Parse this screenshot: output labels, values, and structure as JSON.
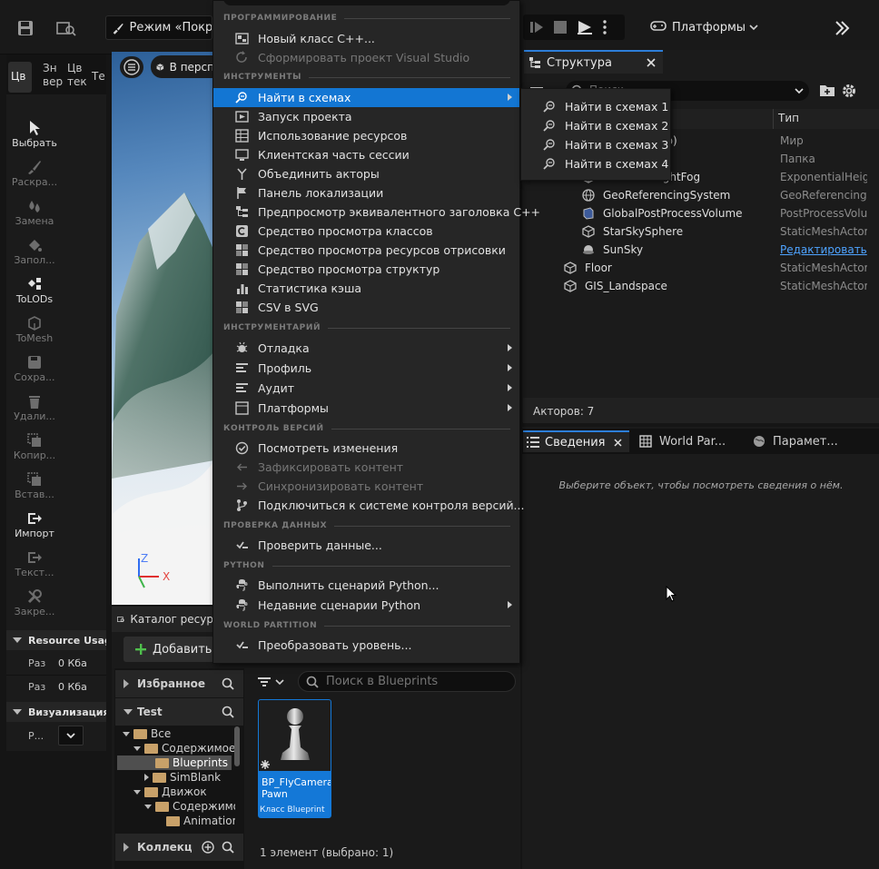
{
  "toolbar": {
    "mode_label": "Режим «Покрас",
    "platforms_label": "Платформы"
  },
  "left_tabs": [
    "Цв",
    "Зн вер",
    "Цв тек",
    "Те"
  ],
  "tools": [
    {
      "label": "Выбрать",
      "active": true
    },
    {
      "label": "Раскра...",
      "active": false
    },
    {
      "label": "Замена",
      "active": false
    },
    {
      "label": "Запол...",
      "active": false
    },
    {
      "label": "ToLODs",
      "active": true
    },
    {
      "label": "ToMesh",
      "active": false
    },
    {
      "label": "Сохра...",
      "active": false
    },
    {
      "label": "Удали...",
      "active": false
    },
    {
      "label": "Копир...",
      "active": false
    },
    {
      "label": "Встав...",
      "active": false
    },
    {
      "label": "Импорт",
      "active": true
    },
    {
      "label": "Текст...",
      "active": false
    },
    {
      "label": "Закре...",
      "active": false
    }
  ],
  "resource_usage": {
    "title": "Resource Usage",
    "rows": [
      {
        "label": "Раз",
        "value": "0 Кба"
      },
      {
        "label": "Раз",
        "value": "0 Кба"
      }
    ]
  },
  "visualization": {
    "title": "Визуализация",
    "row_label": "Р..."
  },
  "viewport": {
    "perspective_label": "В персп",
    "axis_z": "Z",
    "axis_x": "X"
  },
  "content_browser": {
    "tab_label": "Каталог ресур",
    "add_label": "Добавить",
    "favorites_label": "Избранное",
    "project_label": "Test",
    "collections_label": "Коллекци",
    "search_placeholder": "Поиск в Blueprints",
    "tree": [
      {
        "label": "Все",
        "indent": 0,
        "state": "open",
        "selected": false
      },
      {
        "label": "Содержимое",
        "indent": 1,
        "state": "open",
        "selected": false
      },
      {
        "label": "Blueprints",
        "indent": 2,
        "state": "none",
        "selected": true
      },
      {
        "label": "SimBlank",
        "indent": 2,
        "state": "closed",
        "selected": false
      },
      {
        "label": "Движок",
        "indent": 1,
        "state": "open",
        "selected": false
      },
      {
        "label": "Содержимое",
        "indent": 2,
        "state": "open",
        "selected": false
      },
      {
        "label": "Animation",
        "indent": 3,
        "state": "none",
        "selected": false
      }
    ],
    "asset": {
      "name": "BP_FlyCamera Pawn",
      "type": "Класс Blueprint"
    },
    "status": "1 элемент (выбрано: 1)"
  },
  "outliner": {
    "tab_label": "Структура",
    "search_placeholder": "Поиск",
    "col_type": "Тип",
    "rows": [
      {
        "name": "ор)",
        "type": "Мир",
        "icon": "world-icon",
        "link": false
      },
      {
        "name": "",
        "type": "Папка",
        "icon": "folder-icon",
        "link": false
      },
      {
        "name": "HeightFog",
        "type": "ExponentialHeightFog",
        "icon": "fog-icon",
        "link": false
      },
      {
        "name": "GeoReferencingSystem",
        "type": "GeoReferencingSystem",
        "icon": "globe-icon",
        "link": false
      },
      {
        "name": "GlobalPostProcessVolume",
        "type": "PostProcessVolume",
        "icon": "cube-icon",
        "link": false
      },
      {
        "name": "StarSkySphere",
        "type": "StaticMeshActor",
        "icon": "mesh-icon",
        "link": false
      },
      {
        "name": "SunSky",
        "type": "Редактировать",
        "icon": "sun-icon",
        "link": true
      },
      {
        "name": "Floor",
        "type": "StaticMeshActor",
        "icon": "mesh-icon",
        "link": false
      },
      {
        "name": "GIS_Landspace",
        "type": "StaticMeshActor",
        "icon": "mesh-icon",
        "link": false
      }
    ],
    "actors_count": "Акторов: 7"
  },
  "details": {
    "tabs": [
      "Сведения",
      "World Par...",
      "Парамет..."
    ],
    "empty_text": "Выберите объект, чтобы посмотреть сведения о нём."
  },
  "menu": {
    "sections": [
      {
        "title": "ПРОГРАММИРОВАНИЕ",
        "items": [
          {
            "label": "Новый класс C++...",
            "icon": "cpp-class-icon",
            "disabled": false,
            "submenu": false,
            "highlighted": false
          },
          {
            "label": "Сформировать проект Visual Studio",
            "icon": "refresh-icon",
            "disabled": true,
            "submenu": false,
            "highlighted": false
          }
        ]
      },
      {
        "title": "ИНСТРУМЕНТЫ",
        "items": [
          {
            "label": "Найти в схемах",
            "icon": "find-in-blueprints-icon",
            "disabled": false,
            "submenu": true,
            "highlighted": true
          },
          {
            "label": "Запуск проекта",
            "icon": "project-launcher-icon",
            "disabled": false,
            "submenu": false,
            "highlighted": false
          },
          {
            "label": "Использование ресурсов",
            "icon": "resource-usage-icon",
            "disabled": false,
            "submenu": false,
            "highlighted": false
          },
          {
            "label": "Клиентская часть сессии",
            "icon": "session-frontend-icon",
            "disabled": false,
            "submenu": false,
            "highlighted": false
          },
          {
            "label": "Объединить акторы",
            "icon": "merge-actors-icon",
            "disabled": false,
            "submenu": false,
            "highlighted": false
          },
          {
            "label": "Панель локализации",
            "icon": "flag-icon",
            "disabled": false,
            "submenu": false,
            "highlighted": false
          },
          {
            "label": "Предпросмотр эквивалентного заголовка C++",
            "icon": "header-preview-icon",
            "disabled": false,
            "submenu": false,
            "highlighted": false
          },
          {
            "label": "Средство просмотра классов",
            "icon": "class-viewer-icon",
            "disabled": false,
            "submenu": false,
            "highlighted": false
          },
          {
            "label": "Средство просмотра ресурсов отрисовки",
            "icon": "render-resource-icon",
            "disabled": false,
            "submenu": false,
            "highlighted": false
          },
          {
            "label": "Средство просмотра структур",
            "icon": "struct-viewer-icon",
            "disabled": false,
            "submenu": false,
            "highlighted": false
          },
          {
            "label": "Статистика кэша",
            "icon": "bar-chart-icon",
            "disabled": false,
            "submenu": false,
            "highlighted": false
          },
          {
            "label": "CSV в SVG",
            "icon": "csv-icon",
            "disabled": false,
            "submenu": false,
            "highlighted": false
          }
        ]
      },
      {
        "title": "ИНСТРУМЕНТАРИЙ",
        "items": [
          {
            "label": "Отладка",
            "icon": "debug-icon",
            "disabled": false,
            "submenu": true,
            "highlighted": false
          },
          {
            "label": "Профиль",
            "icon": "profile-icon",
            "disabled": false,
            "submenu": true,
            "highlighted": false
          },
          {
            "label": "Аудит",
            "icon": "audit-icon",
            "disabled": false,
            "submenu": true,
            "highlighted": false
          },
          {
            "label": "Платформы",
            "icon": "platforms-icon",
            "disabled": false,
            "submenu": true,
            "highlighted": false
          }
        ]
      },
      {
        "title": "КОНТРОЛЬ ВЕРСИЙ",
        "items": [
          {
            "label": "Посмотреть изменения",
            "icon": "check-circle-icon",
            "disabled": false,
            "submenu": false,
            "highlighted": false
          },
          {
            "label": "Зафиксировать контент",
            "icon": "arrow-left-icon",
            "disabled": true,
            "submenu": false,
            "highlighted": false
          },
          {
            "label": "Синхронизировать контент",
            "icon": "arrow-right-icon",
            "disabled": true,
            "submenu": false,
            "highlighted": false
          },
          {
            "label": "Подключиться к системе контроля версий...",
            "icon": "branch-icon",
            "disabled": false,
            "submenu": false,
            "highlighted": false
          }
        ]
      },
      {
        "title": "ПРОВЕРКА ДАННЫХ",
        "items": [
          {
            "label": "Проверить данные...",
            "icon": "validate-icon",
            "disabled": false,
            "submenu": false,
            "highlighted": false
          }
        ]
      },
      {
        "title": "PYTHON",
        "items": [
          {
            "label": "Выполнить сценарий Python...",
            "icon": "python-icon",
            "disabled": false,
            "submenu": false,
            "highlighted": false
          },
          {
            "label": "Недавние сценарии Python",
            "icon": "python-recent-icon",
            "disabled": false,
            "submenu": true,
            "highlighted": false
          }
        ]
      },
      {
        "title": "WORLD PARTITION",
        "items": [
          {
            "label": "Преобразовать уровень...",
            "icon": "convert-level-icon",
            "disabled": false,
            "submenu": false,
            "highlighted": false
          }
        ]
      }
    ]
  },
  "submenu": {
    "items": [
      "Найти в схемах 1",
      "Найти в схемах 2",
      "Найти в схемах 3",
      "Найти в схемах 4"
    ]
  },
  "colors": {
    "accent": "#1376d3",
    "menu_bg": "#262626",
    "panel_bg": "#1b1b1b",
    "folder": "#c8a169",
    "link": "#4ea3ff"
  }
}
